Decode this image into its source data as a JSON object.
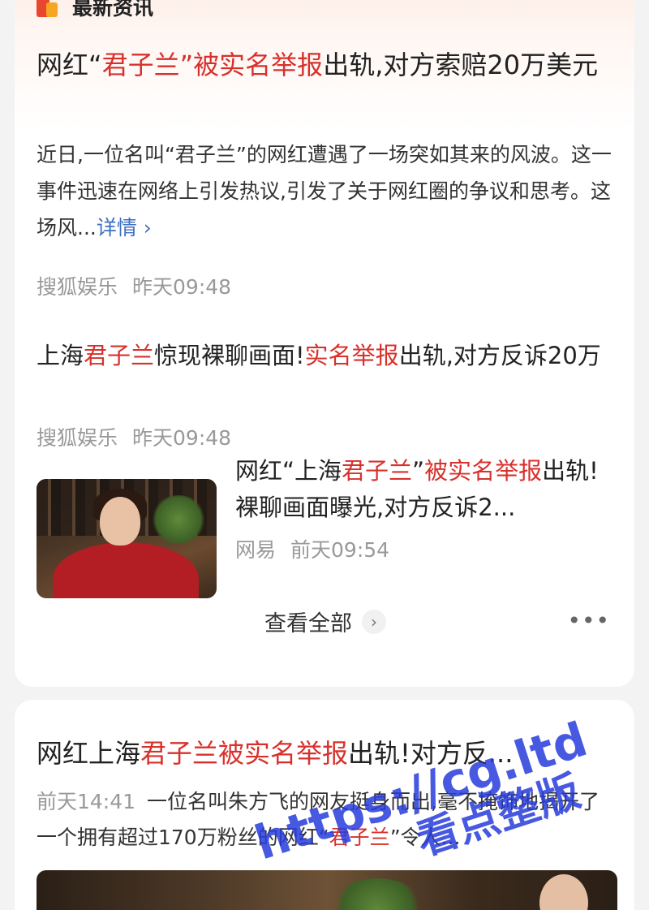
{
  "section": {
    "title": "最新资讯"
  },
  "article1": {
    "title_pre": "网红“",
    "title_hl1": "君子兰”被实名举报",
    "title_post": "出轨,对方索赔20万美元",
    "summary": "近日,一位名叫“君子兰”的网红遭遇了一场突如其来的风波。这一事件迅速在网络上引发热议,引发了关于网红圈的争议和思考。这场风...",
    "more_link": "详情 ›",
    "source": "搜狐娱乐",
    "time": "昨天09:48"
  },
  "article2": {
    "t1": "上海",
    "t2": "君子兰",
    "t3": "惊现裸聊画面!",
    "t4": "实名举报",
    "t5": "出轨,对方反诉20万",
    "source": "搜狐娱乐",
    "time": "昨天09:48"
  },
  "article3": {
    "t1": "网红“上海",
    "t2": "君子兰",
    "t3": "”",
    "t4": "被实名举报",
    "t5": "出轨!裸聊画面曝光,对方反诉2...",
    "source": "网易",
    "time": "前天09:54"
  },
  "view_all": {
    "label": "查看全部"
  },
  "more_dots": "•••",
  "card2": {
    "t1": "网红上海",
    "t2": "君子兰被实名举报",
    "t3": "出轨!对方反...",
    "time": "前天14:41",
    "summary_a": "一位名叫朱方飞的网友挺身而出,毫不掩饰地揭开了一个拥有超过170万粉丝的网红“",
    "summary_hl": "君子兰",
    "summary_b": "”令人..."
  },
  "watermark": {
    "line1": "https://cg.ltd",
    "line2": "看点整版"
  },
  "colors": {
    "highlight": "#d8312c",
    "link": "#3f6fc1",
    "meta": "#999999"
  }
}
